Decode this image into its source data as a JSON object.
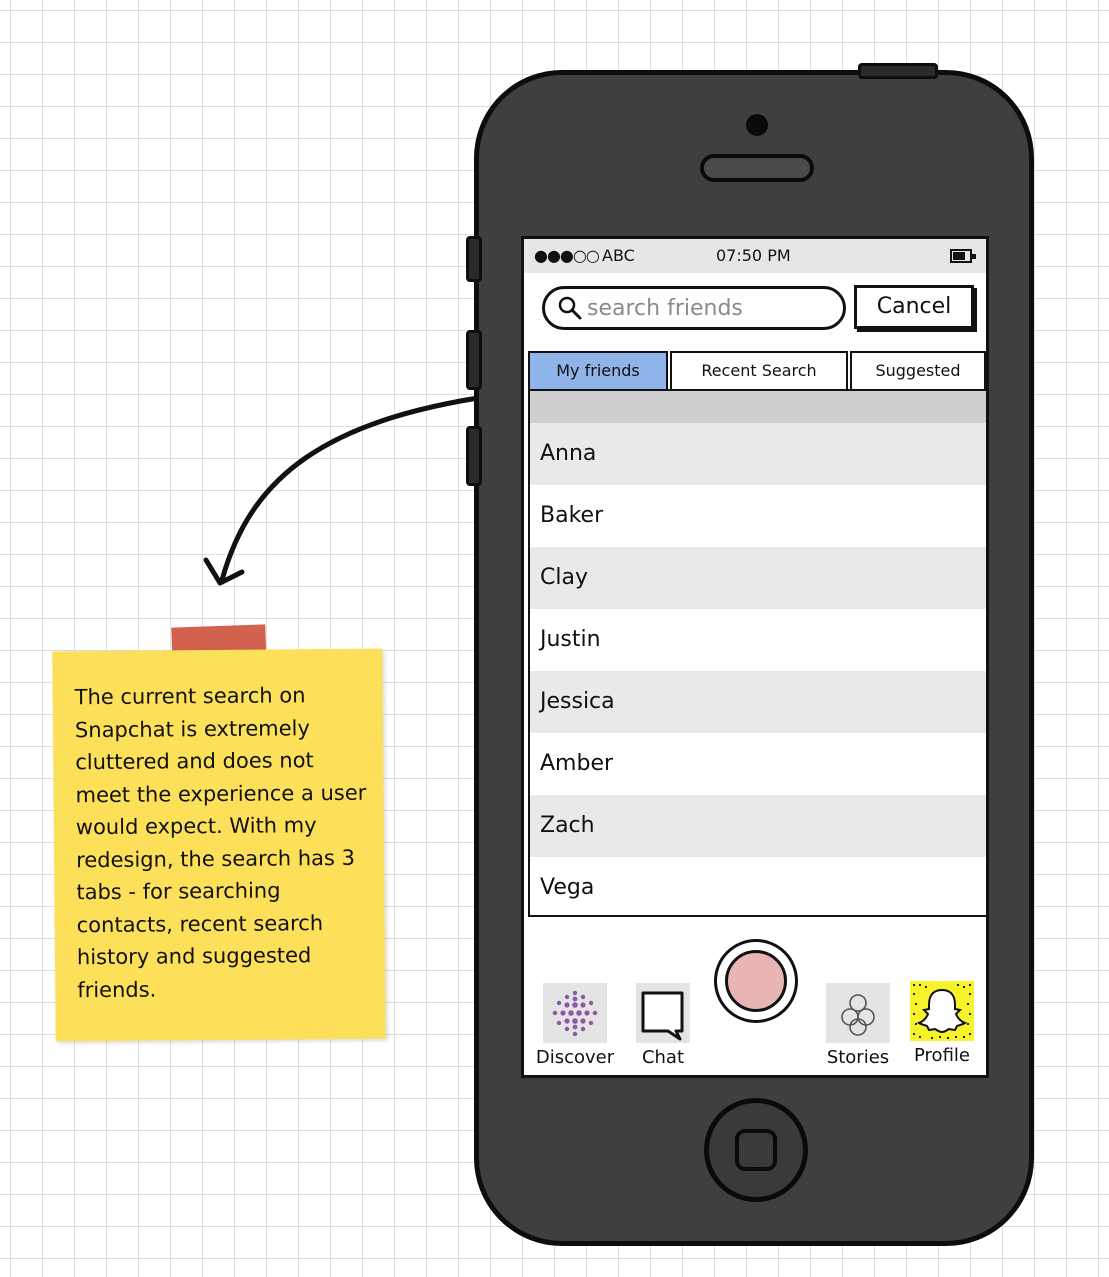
{
  "status_bar": {
    "signal": "●●●○○",
    "carrier": "ABC",
    "time": "07:50 PM"
  },
  "search": {
    "placeholder": "search friends",
    "cancel_label": "Cancel"
  },
  "tabs": [
    {
      "label": "My friends",
      "active": true
    },
    {
      "label": "Recent Search",
      "active": false
    },
    {
      "label": "Suggested",
      "active": false
    }
  ],
  "friends": [
    "Anna",
    "Baker",
    "Clay",
    "Justin",
    "Jessica",
    "Amber",
    "Zach",
    "Vega"
  ],
  "bottom_nav": {
    "discover": "Discover",
    "chat": "Chat",
    "stories": "Stories",
    "profile": "Profile"
  },
  "note": {
    "text": "The current search on Snapchat is extremely cluttered and does not meet the experience a user would expect. With my redesign, the search has 3 tabs - for searching contacts, recent search history and suggested friends."
  },
  "colors": {
    "active_tab": "#8fb4ea",
    "note_background": "#fde05a",
    "note_tape": "#d05a45",
    "capture_button": "#e8b4b4",
    "profile_background": "#f8f22a",
    "discover_dots": "#8a5aa8"
  },
  "icons": {
    "search": "magnifier-icon",
    "battery": "battery-icon",
    "discover": "discover-dots-icon",
    "chat": "chat-bubble-icon",
    "stories": "stories-circles-icon",
    "profile": "snapchat-ghost-icon",
    "capture": "capture-circle-icon"
  }
}
